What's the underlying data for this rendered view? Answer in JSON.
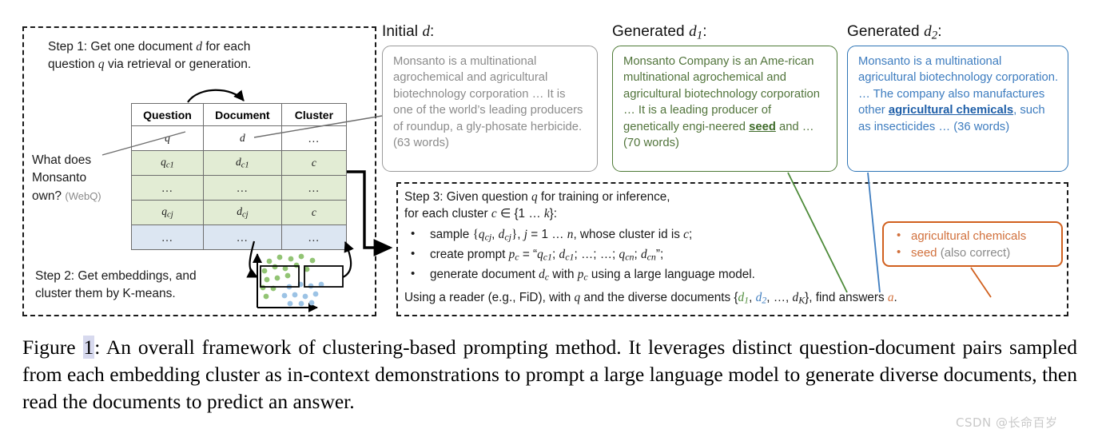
{
  "left_panel": {
    "step1": "Step 1: Get one document d for each question q via retrieval or generation.",
    "step1_line1_pre": "Step 1: Get one document ",
    "step1_line1_post": " for each",
    "step1_line2_pre": "question ",
    "step1_line2_post": " via retrieval or generation.",
    "step2_line1": "Step 2: Get embeddings, and",
    "step2_line2": "cluster them by K-means.",
    "question_line1": "What does",
    "question_line2": "Monsanto",
    "question_line3": "own?",
    "question_source": "(WebQ)"
  },
  "table": {
    "headers": [
      "Question",
      "Document",
      "Cluster"
    ],
    "rows": [
      {
        "q": "q",
        "d": "d",
        "c": "...",
        "style": "plain"
      },
      {
        "q": "qc1",
        "d": "dc1",
        "c": "c",
        "style": "green"
      },
      {
        "q": "...",
        "d": "...",
        "c": "...",
        "style": "green"
      },
      {
        "q": "qcj",
        "d": "dcj",
        "c": "c",
        "style": "green"
      },
      {
        "q": "...",
        "d": "...",
        "c": "...",
        "style": "blue"
      }
    ]
  },
  "documents": [
    {
      "title_prefix": "Initial ",
      "title_symbol": "d",
      "title_sub": "",
      "title_suffix": ":",
      "text": "Monsanto is a multinational agrochemical and agricultural biotechnology corporation ... It is one of the world’s leading producers of roundup, a gly-phosate herbicide. (63 words)",
      "word_count": "(63 words)",
      "color": "#8b8b8b",
      "border_color": "#9a9a9a"
    },
    {
      "title_prefix": "Generated ",
      "title_symbol": "d",
      "title_sub": "1",
      "title_suffix": ":",
      "text": "Monsanto Company is an Ame-rican multinational agrochemical and agricultural biotechnology corporation ... It is a leading producer of genetically engi-neered seed and ... (70 words)",
      "highlight": "seed",
      "word_count": "(70 words)",
      "color": "#51743b",
      "border_color": "#4e7a36"
    },
    {
      "title_prefix": "Generated ",
      "title_symbol": "d",
      "title_sub": "2",
      "title_suffix": ":",
      "text": "Monsanto is a multinational agricultural biotechnology corporation. ... The company also manufactures other agricultural chemicals, such as insecticides ... (36 words)",
      "highlight": "agricultural chemicals",
      "word_count": "(36 words)",
      "color": "#3d7cbf",
      "border_color": "#2e75b6"
    }
  ],
  "step3": {
    "line1_a": "Step 3: Given question ",
    "line1_q": "q",
    "line1_b": " for training or inference,",
    "line2_a": "for each cluster ",
    "line2_c": "c",
    "line2_b": " ∈ {1 … k}:",
    "bullet1": "sample {qcj, dcj}, j = 1 … n, whose cluster id is c;",
    "bullet2": "create prompt pc = “qc1; dc1; …; …; qcn; dcn”;",
    "bullet3": "generate document dc with pc using a large language model.",
    "final": "Using a reader (e.g., FiD), with q and the diverse documents {d1, d2, …, dK}, find answers a."
  },
  "answer_box": {
    "items": [
      "agricultural chemicals",
      "seed"
    ],
    "note": "(also correct)",
    "accent": "#d1601e"
  },
  "caption": {
    "prefix": "Figure ",
    "number": "1",
    "text": ": An overall framework of clustering-based prompting method. It leverages distinct question-document pairs sampled from each embedding cluster as in-context demonstrations to prompt a large language model to generate diverse documents, then read the documents to predict an answer."
  },
  "watermark": "CSDN @长命百岁"
}
